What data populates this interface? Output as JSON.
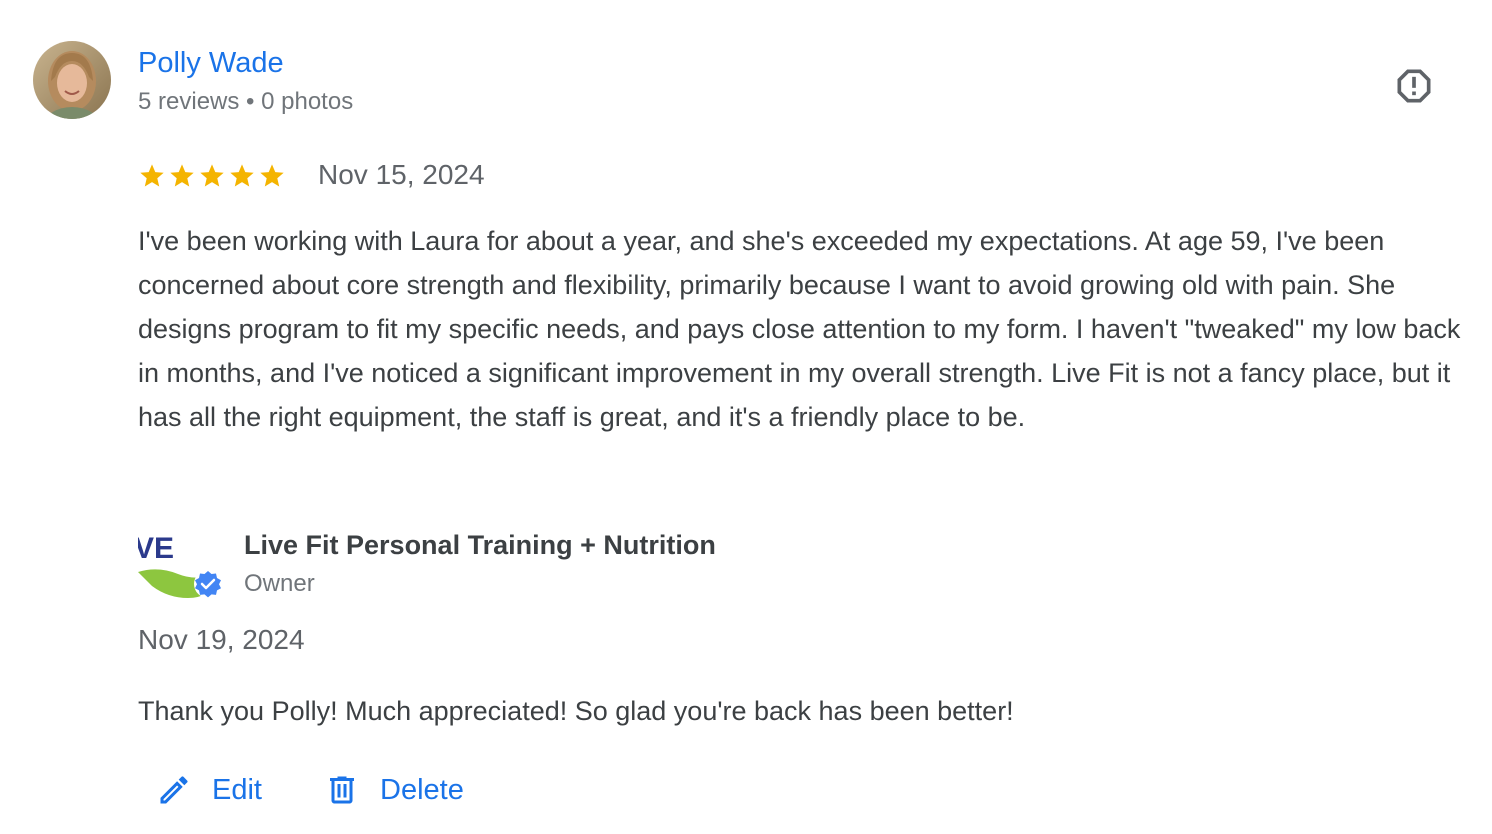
{
  "reviewer": {
    "name": "Polly Wade",
    "reviews_count": "5 reviews",
    "separator": "•",
    "photos_count": "0 photos",
    "avatar_icon": "person-photo"
  },
  "review": {
    "rating": 5,
    "max_rating": 5,
    "date": "Nov 15, 2024",
    "text": "I've been working with Laura for about a year, and she's exceeded my expectations. At age 59, I've been concerned about core strength and flexibility, primarily because I want to avoid growing old with pain. She designs program to fit my specific needs, and pays close attention to my form. I haven't \"tweaked\" my low back in months, and I've noticed a significant improvement in my overall strength. Live Fit is not a fancy place, but it has all the right equipment, the staff is great, and it's a friendly place to be."
  },
  "owner_reply": {
    "business_name": "Live Fit Personal Training + Nutrition",
    "role": "Owner",
    "logo_text": "VE",
    "date": "Nov 19, 2024",
    "text": "Thank you Polly! Much appreciated! So glad you're back has been better!"
  },
  "actions": {
    "edit_label": "Edit",
    "edit_icon": "pencil-icon",
    "delete_label": "Delete",
    "delete_icon": "trash-icon"
  },
  "flag": {
    "icon": "report-icon"
  },
  "colors": {
    "link_blue": "#1a73e8",
    "star_gold": "#f4b400",
    "text_dark": "#3c4043",
    "text_muted": "#70757a",
    "verified_blue": "#4285f4"
  }
}
